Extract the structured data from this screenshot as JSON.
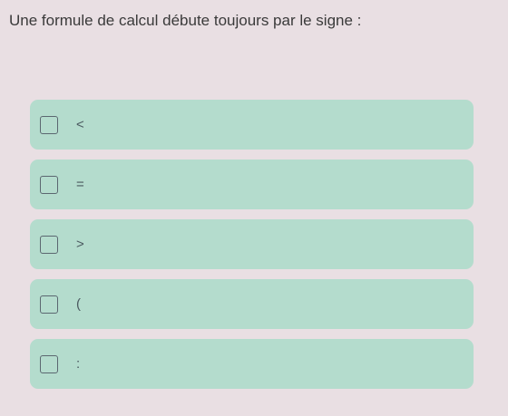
{
  "question": {
    "text": "Une formule de calcul débute toujours par le signe :"
  },
  "options": [
    {
      "label": "<"
    },
    {
      "label": "="
    },
    {
      "label": ">"
    },
    {
      "label": "("
    },
    {
      "label": ":"
    }
  ],
  "colors": {
    "background": "#e9dfe3",
    "option_background": "#b4dccd",
    "checkbox_border": "#5b6770"
  }
}
